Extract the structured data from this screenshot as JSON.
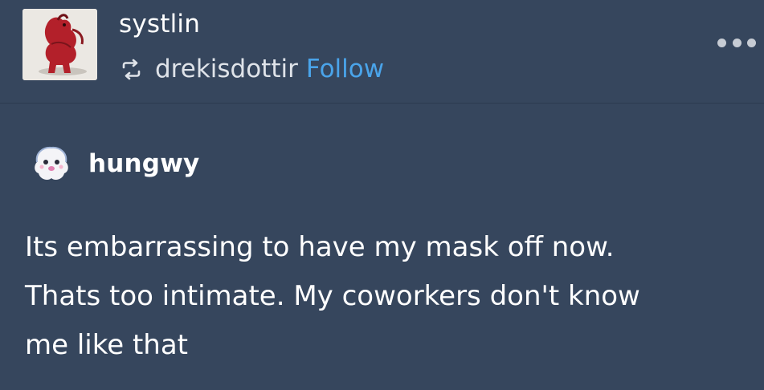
{
  "post": {
    "blog_name": "systlin",
    "reblog": {
      "icon": "reblog-icon",
      "source_blog": "drekisdottir",
      "follow_label": "Follow"
    },
    "menu_icon": "more-horizontal-icon",
    "avatar_icon": "red-horse-avatar",
    "colors": {
      "background": "#36465d",
      "follow_link": "#4aa4ea",
      "text": "#ffffff"
    }
  },
  "trail": {
    "avatar_icon": "ghost-avatar",
    "username": "hungwy",
    "body_lines": [
      "Its embarrassing to have my mask off now.",
      "Thats too intimate. My coworkers don't know",
      "me like that"
    ]
  }
}
